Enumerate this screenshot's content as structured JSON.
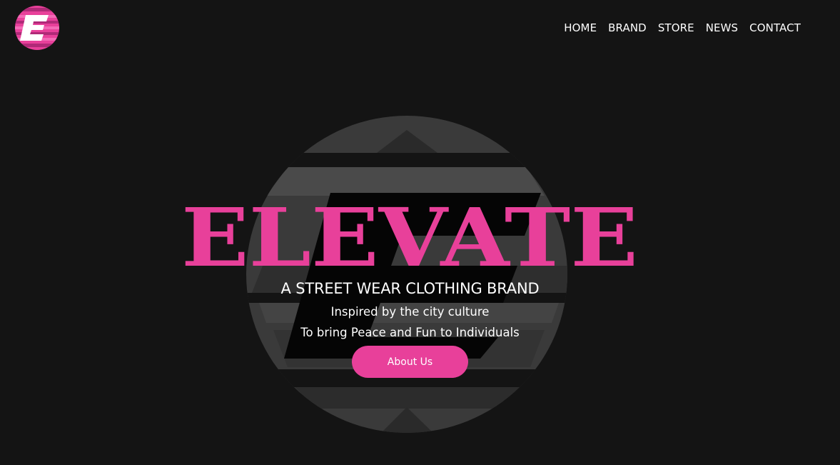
{
  "brand": {
    "logo_icon": "elevate-e-logo-icon",
    "accent_color": "#e8409a",
    "background_color": "#141414",
    "hero_title": "ELEVATE"
  },
  "nav": {
    "items": [
      {
        "label": "HOME"
      },
      {
        "label": "BRAND"
      },
      {
        "label": "STORE"
      },
      {
        "label": "NEWS"
      },
      {
        "label": "CONTACT"
      }
    ]
  },
  "hero": {
    "tagline": "A STREET WEAR CLOTHING BRAND",
    "line1": "Inspired by the city culture",
    "line2": "To bring Peace and Fun to Individuals",
    "button_label": "About Us"
  }
}
